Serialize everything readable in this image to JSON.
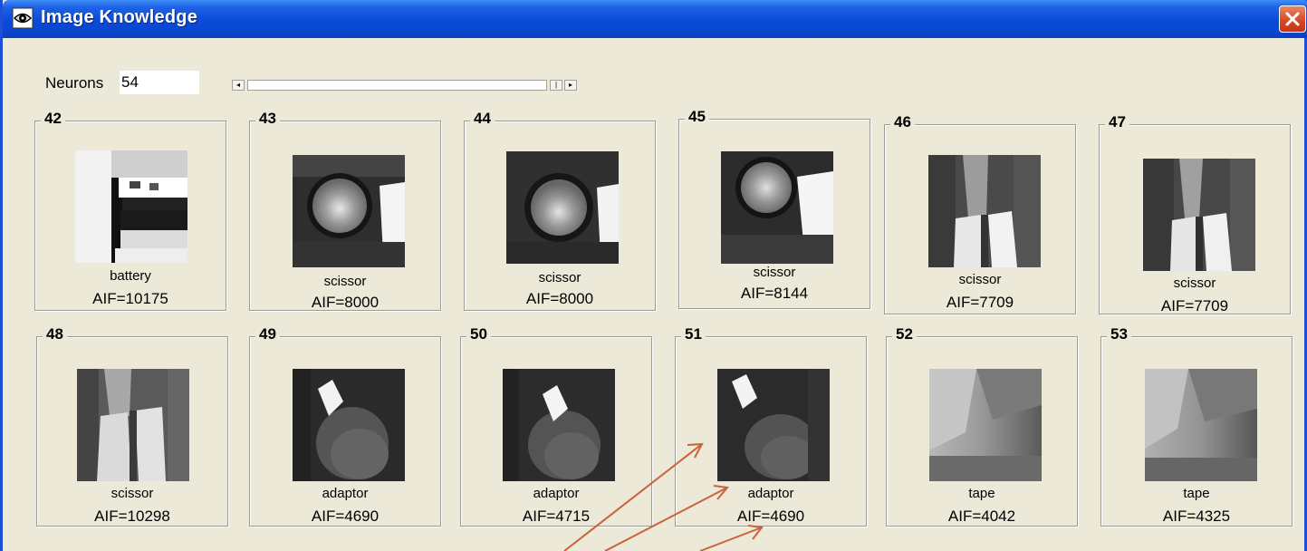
{
  "window": {
    "title": "Image Knowledge"
  },
  "controls": {
    "neurons_label": "Neurons",
    "neurons_value": "54"
  },
  "neurons": [
    {
      "id": "42",
      "label": "battery",
      "aif": "AIF=10175"
    },
    {
      "id": "43",
      "label": "scissor",
      "aif": "AIF=8000"
    },
    {
      "id": "44",
      "label": "scissor",
      "aif": "AIF=8000"
    },
    {
      "id": "45",
      "label": "scissor",
      "aif": "AIF=8144"
    },
    {
      "id": "46",
      "label": "scissor",
      "aif": "AIF=7709"
    },
    {
      "id": "47",
      "label": "scissor",
      "aif": "AIF=7709"
    },
    {
      "id": "48",
      "label": "scissor",
      "aif": "AIF=10298"
    },
    {
      "id": "49",
      "label": "adaptor",
      "aif": "AIF=4690"
    },
    {
      "id": "50",
      "label": "adaptor",
      "aif": "AIF=4715"
    },
    {
      "id": "51",
      "label": "adaptor",
      "aif": "AIF=4690"
    },
    {
      "id": "52",
      "label": "tape",
      "aif": "AIF=4042"
    },
    {
      "id": "53",
      "label": "tape",
      "aif": "AIF=4325"
    }
  ],
  "colors": {
    "titlebar": "#0a4ad8",
    "window_bg": "#ece9d8",
    "annotation_arrow": "#c8643c",
    "close": "#d6461f"
  },
  "icons": {
    "app": "eye-shield-icon",
    "close": "close-icon"
  }
}
